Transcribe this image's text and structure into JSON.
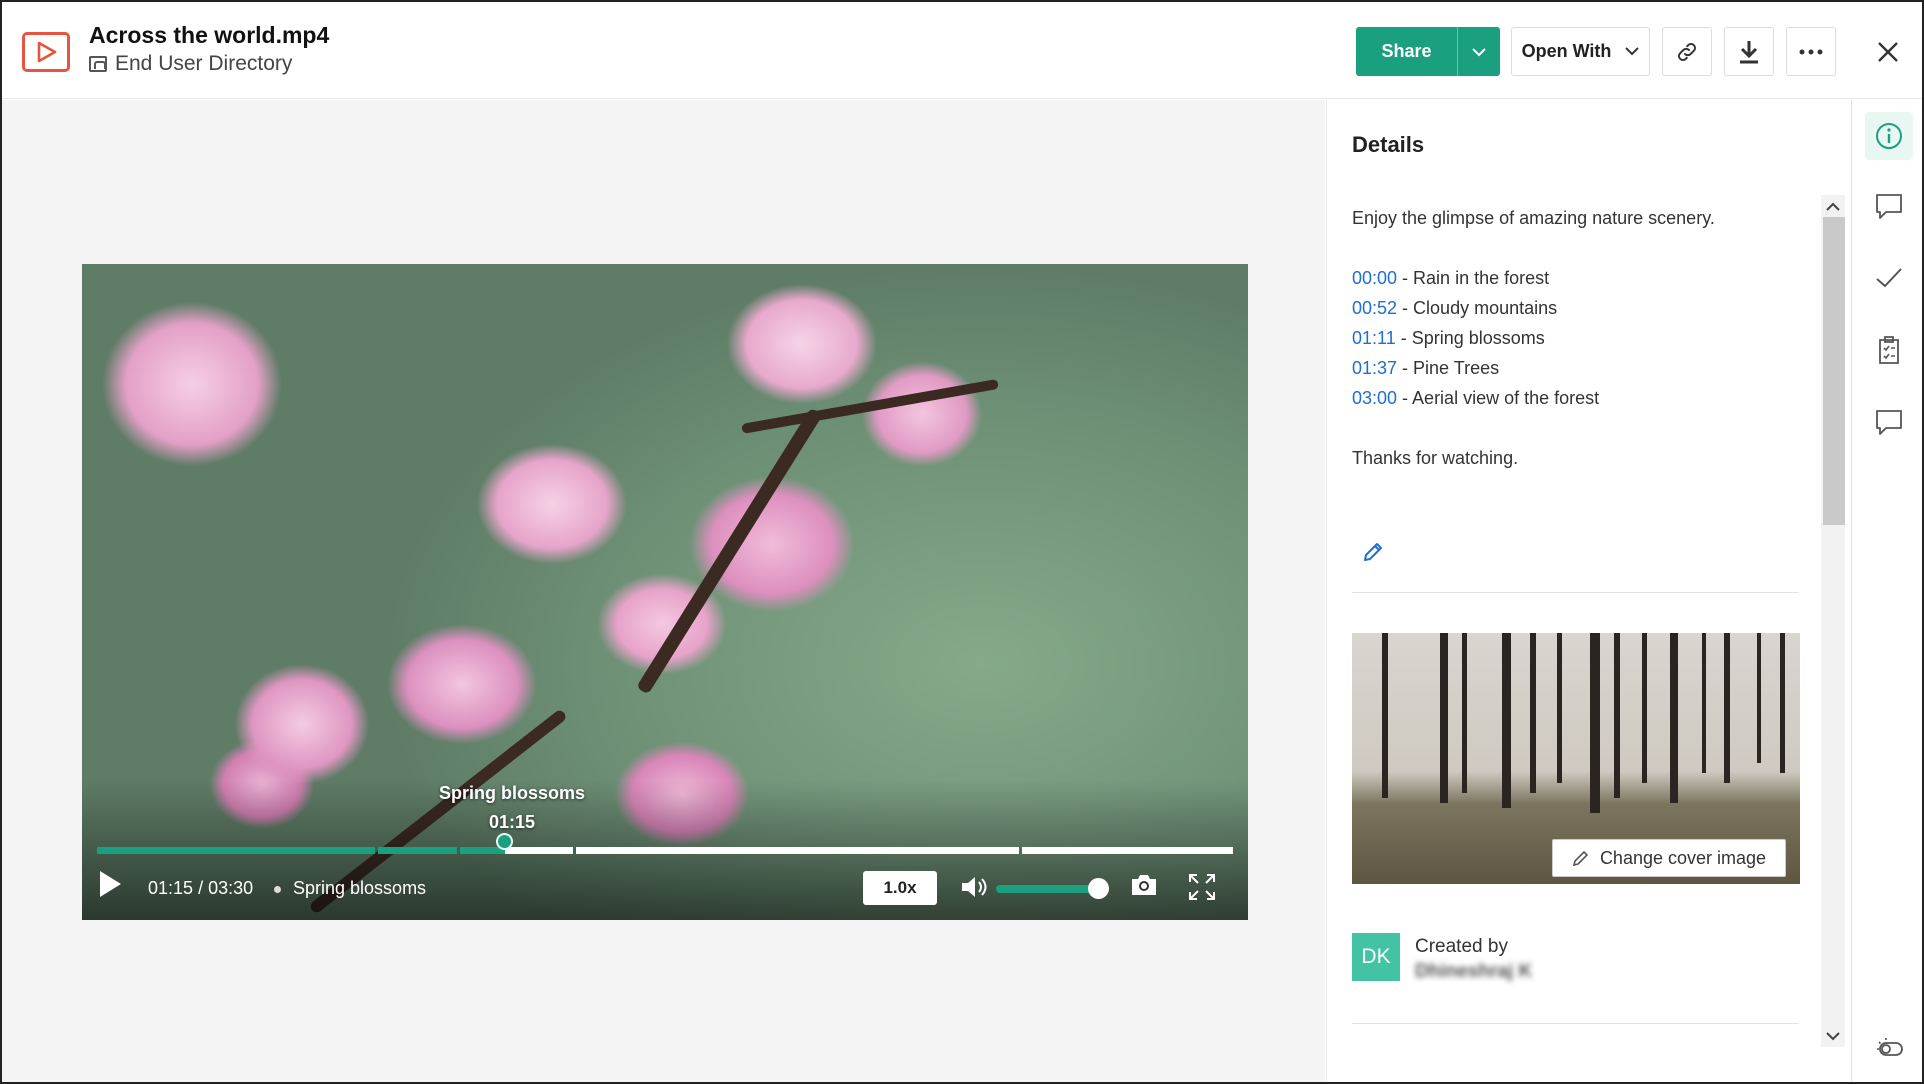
{
  "header": {
    "file_icon": "video-file-icon",
    "file_name": "Across the world.mp4",
    "folder_icon": "team-folder-icon",
    "folder_name": "End User Directory",
    "share_label": "Share",
    "open_with_label": "Open With",
    "icons": [
      "link-icon",
      "download-icon",
      "more-icon",
      "close-icon"
    ]
  },
  "player": {
    "chapter_tooltip_title": "Spring blossoms",
    "chapter_tooltip_time": "01:15",
    "current_time": "01:15",
    "separator": "/",
    "duration": "03:30",
    "current_chapter": "Spring blossoms",
    "speed": "1.0x",
    "progress_fraction": 0.357,
    "volume_fraction": 1.0,
    "accent_color": "#1a9f7f"
  },
  "details": {
    "title": "Details",
    "description": "Enjoy the glimpse of amazing nature scenery.",
    "chapters": [
      {
        "time": "00:00",
        "label": " - Rain in the forest"
      },
      {
        "time": "00:52",
        "label": " - Cloudy mountains"
      },
      {
        "time": "01:11",
        "label": " - Spring blossoms"
      },
      {
        "time": "01:37",
        "label": " - Pine Trees"
      },
      {
        "time": "03:00",
        "label": " - Aerial view of the forest"
      }
    ],
    "closing": "Thanks for watching.",
    "change_cover_label": "Change cover image",
    "created_by_label": "Created by",
    "creator_initials": "DK",
    "creator_name": "Dhineshraj K",
    "link_color": "#1f6fd1"
  },
  "rail": {
    "items": [
      "info-icon",
      "comment-icon",
      "checkmark-icon",
      "task-clipboard-icon",
      "chat-icon",
      "theme-toggle-icon"
    ]
  }
}
